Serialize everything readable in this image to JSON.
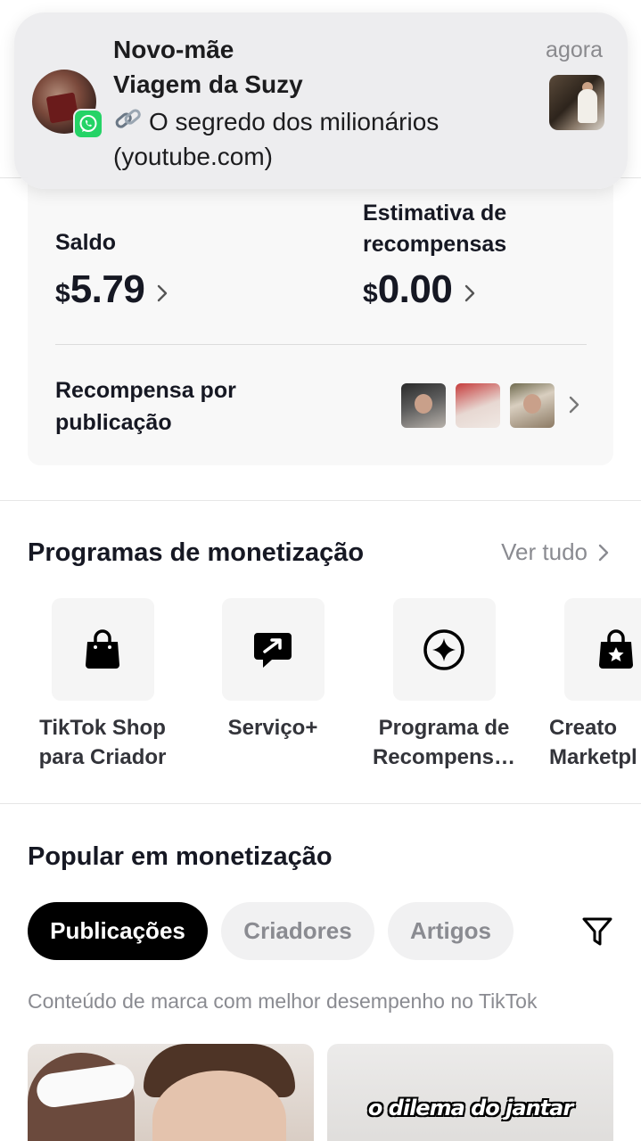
{
  "notification": {
    "title": "Novo-mãe",
    "subtitle": "Viagem da Suzy",
    "body": "O segredo dos milionários (youtube.com)",
    "time": "agora",
    "app_icon": "whatsapp-icon",
    "link_icon": "link-icon"
  },
  "balance": {
    "saldo_label": "Saldo",
    "currency": "$",
    "saldo_value": "5.79",
    "estimate_label": "Estimativa de recompensas",
    "estimate_value": "0.00",
    "reward_label": "Recompensa por publicação"
  },
  "programs": {
    "title": "Programas de monetização",
    "see_all": "Ver tudo",
    "items": [
      {
        "label": "TikTok Shop para Criador",
        "icon": "shopping-bag-icon"
      },
      {
        "label": "Serviço+",
        "icon": "chat-arrow-icon"
      },
      {
        "label": "Programa de Recompens…",
        "icon": "sparkle-circle-icon"
      },
      {
        "label": "Creato Marketpl",
        "icon": "star-bag-icon"
      }
    ]
  },
  "popular": {
    "title": "Popular em monetização",
    "tabs": [
      {
        "label": "Publicações",
        "active": true
      },
      {
        "label": "Criadores",
        "active": false
      },
      {
        "label": "Artigos",
        "active": false
      }
    ],
    "caption": "Conteúdo de marca com melhor desempenho no TikTok",
    "cards": [
      {
        "overlay": ""
      },
      {
        "overlay": "o dilema do jantar"
      }
    ]
  },
  "colors": {
    "whatsapp": "#25d366",
    "active_chip": "#000000",
    "muted_text": "#8a8b91"
  }
}
